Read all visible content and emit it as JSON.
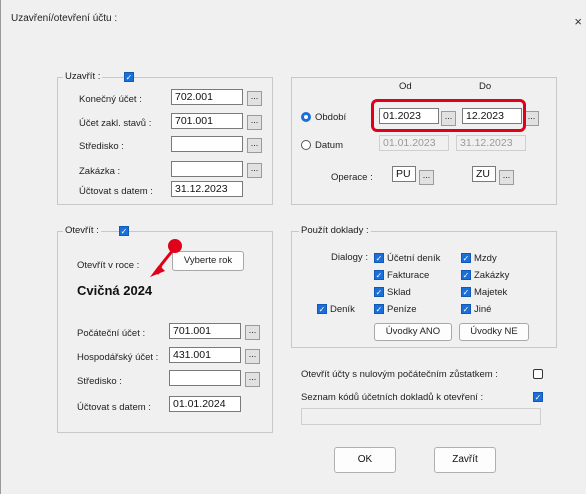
{
  "window": {
    "title": "Uzavření/otevření účtu :",
    "close": "×"
  },
  "ucet_group": {
    "label": "Uzavřít :",
    "rows": [
      {
        "label": "Konečný účet :",
        "value": "702.001"
      },
      {
        "label": "Účet zakl. stavů :",
        "value": "701.001"
      },
      {
        "label": "Středisko :",
        "value": ""
      },
      {
        "label": "Zakázka :",
        "value": ""
      },
      {
        "label": "Účtovat s datem :",
        "value": "31.12.2023"
      }
    ]
  },
  "date_group": {
    "col_from": "Od",
    "col_to": "Do",
    "obdobi_label": "Období",
    "obdobi_from": "01.2023",
    "obdobi_to": "12.2023",
    "datum_label": "Datum",
    "datum_from": "01.01.2023",
    "datum_to": "31.12.2023",
    "operace_label": "Operace :",
    "operace_from": "PU",
    "operace_to": "ZU"
  },
  "otevrit_group": {
    "label": "Otevřít :",
    "target_label": "Otevřít v roce :",
    "select_button": "Vyberte rok",
    "target_year": "Cvičná 2024",
    "rows": [
      {
        "label": "Počáteční účet :",
        "value": "701.001"
      },
      {
        "label": "Hospodářský účet :",
        "value": "431.001"
      },
      {
        "label": "Středisko :",
        "value": ""
      },
      {
        "label": "Účtovat s datem :",
        "value": "01.01.2024"
      }
    ]
  },
  "pouzit_group": {
    "label": "Použít doklady :",
    "dialogs_label": "Dialogy :",
    "checks": [
      {
        "label": "Účetní deník",
        "checked": true
      },
      {
        "label": "Fakturace",
        "checked": true
      },
      {
        "label": "Sklad",
        "checked": true
      },
      {
        "label": "Peníze",
        "checked": true
      },
      {
        "label": "Mzdy",
        "checked": true
      },
      {
        "label": "Zakázky",
        "checked": true
      },
      {
        "label": "Majetek",
        "checked": true
      },
      {
        "label": "Jiné",
        "checked": true
      }
    ],
    "denik_label": "Deník",
    "btn_all": "Úvodky ANO",
    "btn_none": "Úvodky NE"
  },
  "opts": {
    "opt1": "Otevřít účty s nulovým počátečním zůstatkem :",
    "opt2": "Seznam kódů účetních dokladů k otevření :"
  },
  "buttons": {
    "ok": "OK",
    "cancel": "Zavřít"
  },
  "colors": {
    "accent": "#1b6fd8",
    "highlight": "#e0001a"
  }
}
